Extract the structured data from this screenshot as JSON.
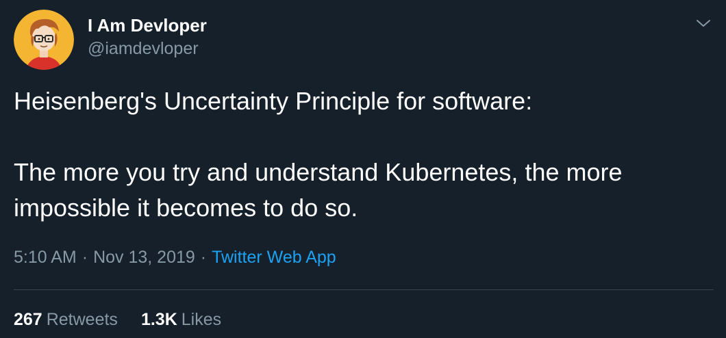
{
  "author": {
    "display_name": "I Am Devloper",
    "handle": "@iamdevloper",
    "avatar_icon": "cartoon-developer-avatar-icon"
  },
  "menu_icon": "chevron-down-icon",
  "tweet": {
    "lines": [
      "Heisenberg's Uncertainty Principle for software:",
      "",
      "The more you try and understand Kubernetes, the more",
      "impossible it becomes to do so."
    ]
  },
  "meta": {
    "time": "5:10 AM",
    "separator": "·",
    "date": "Nov 13, 2019",
    "source": "Twitter Web App"
  },
  "stats": {
    "retweets_count": "267",
    "retweets_label": "Retweets",
    "likes_count": "1.3K",
    "likes_label": "Likes"
  },
  "colors": {
    "background": "#15202b",
    "primary_text": "#ffffff",
    "secondary_text": "#8899a6",
    "link": "#1da1f2",
    "divider": "#38444d"
  }
}
